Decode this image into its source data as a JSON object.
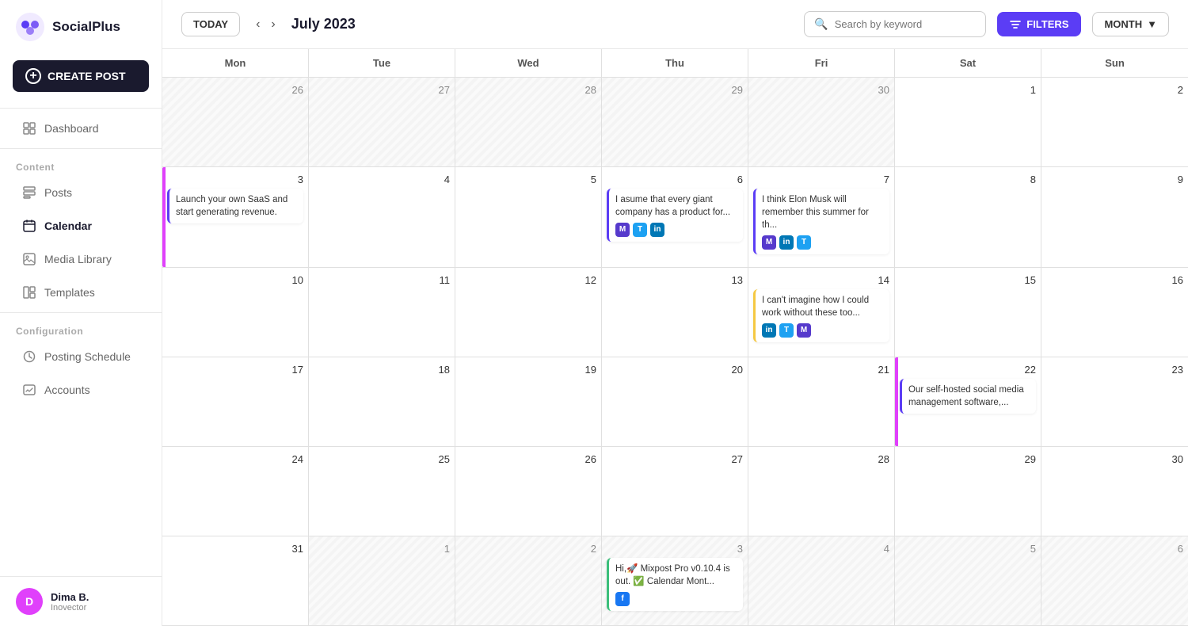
{
  "app": {
    "name": "SocialPlus"
  },
  "sidebar": {
    "create_post_label": "CREATE POST",
    "nav_items": [
      {
        "id": "dashboard",
        "label": "Dashboard",
        "icon": "dashboard-icon"
      },
      {
        "id": "content",
        "label": "Content",
        "section": true
      },
      {
        "id": "posts",
        "label": "Posts",
        "icon": "posts-icon"
      },
      {
        "id": "calendar",
        "label": "Calendar",
        "icon": "calendar-icon",
        "active": true
      },
      {
        "id": "media-library",
        "label": "Media Library",
        "icon": "media-icon"
      },
      {
        "id": "templates",
        "label": "Templates",
        "icon": "templates-icon"
      },
      {
        "id": "configuration",
        "label": "Configuration",
        "section": true
      },
      {
        "id": "posting-schedule",
        "label": "Posting Schedule",
        "icon": "schedule-icon"
      },
      {
        "id": "accounts",
        "label": "Accounts",
        "icon": "accounts-icon"
      }
    ],
    "user": {
      "name": "Dima B.",
      "org": "Inovector",
      "initial": "D"
    }
  },
  "topbar": {
    "today_label": "TODAY",
    "month_title": "July 2023",
    "search_placeholder": "Search by keyword",
    "filters_label": "FILTERS",
    "month_label": "MONTH"
  },
  "calendar": {
    "headers": [
      "Mon",
      "Tue",
      "Wed",
      "Thu",
      "Fri",
      "Sat",
      "Sun"
    ],
    "weeks": [
      {
        "days": [
          {
            "date": "26",
            "other": true,
            "events": []
          },
          {
            "date": "27",
            "other": true,
            "events": []
          },
          {
            "date": "28",
            "other": true,
            "events": []
          },
          {
            "date": "29",
            "other": true,
            "events": []
          },
          {
            "date": "30",
            "other": true,
            "events": []
          },
          {
            "date": "1",
            "other": false,
            "events": []
          },
          {
            "date": "2",
            "other": false,
            "events": []
          }
        ]
      },
      {
        "days": [
          {
            "date": "3",
            "other": false,
            "events": [
              {
                "text": "Launch your own SaaS and start generating revenue.",
                "color": "#5b3df5",
                "accent": "#e040fb",
                "socials": []
              }
            ]
          },
          {
            "date": "4",
            "other": false,
            "events": []
          },
          {
            "date": "5",
            "other": false,
            "events": []
          },
          {
            "date": "6",
            "other": false,
            "events": [
              {
                "text": "I asume that every giant company has a product for...",
                "color": "#5b3df5",
                "accent": "#5b3df5",
                "socials": [
                  "mastodon",
                  "twitter",
                  "linkedin"
                ]
              }
            ]
          },
          {
            "date": "7",
            "other": false,
            "events": [
              {
                "text": "I think Elon Musk will remember this summer for th...",
                "color": "#5b3df5",
                "accent": "#5b3df5",
                "socials": [
                  "mastodon",
                  "linkedin",
                  "twitter"
                ]
              }
            ]
          },
          {
            "date": "8",
            "other": false,
            "events": []
          },
          {
            "date": "9",
            "other": false,
            "events": []
          }
        ]
      },
      {
        "days": [
          {
            "date": "10",
            "other": false,
            "events": []
          },
          {
            "date": "11",
            "other": false,
            "events": []
          },
          {
            "date": "12",
            "other": false,
            "events": []
          },
          {
            "date": "13",
            "other": false,
            "events": []
          },
          {
            "date": "14",
            "other": false,
            "events": [
              {
                "text": "I can't imagine how I could work without these too...",
                "color": "#f5c842",
                "accent": "#f5c842",
                "socials": [
                  "linkedin",
                  "twitter",
                  "mastodon"
                ]
              }
            ]
          },
          {
            "date": "15",
            "other": false,
            "events": []
          },
          {
            "date": "16",
            "other": false,
            "events": []
          }
        ]
      },
      {
        "days": [
          {
            "date": "17",
            "other": false,
            "events": []
          },
          {
            "date": "18",
            "other": false,
            "events": []
          },
          {
            "date": "19",
            "other": false,
            "events": []
          },
          {
            "date": "20",
            "other": false,
            "events": []
          },
          {
            "date": "21",
            "other": false,
            "events": []
          },
          {
            "date": "22",
            "other": false,
            "events": [
              {
                "text": "Our self-hosted social media management software,...",
                "color": "#5b3df5",
                "accent": "#e040fb",
                "socials": []
              }
            ]
          },
          {
            "date": "23",
            "other": false,
            "events": []
          }
        ]
      },
      {
        "days": [
          {
            "date": "24",
            "other": false,
            "events": []
          },
          {
            "date": "25",
            "other": false,
            "events": []
          },
          {
            "date": "26",
            "other": false,
            "events": []
          },
          {
            "date": "27",
            "other": false,
            "events": []
          },
          {
            "date": "28",
            "other": false,
            "events": []
          },
          {
            "date": "29",
            "other": false,
            "events": []
          },
          {
            "date": "30",
            "other": false,
            "events": []
          }
        ]
      },
      {
        "days": [
          {
            "date": "31",
            "other": false,
            "events": []
          },
          {
            "date": "1",
            "other": true,
            "events": []
          },
          {
            "date": "2",
            "other": true,
            "events": []
          },
          {
            "date": "3",
            "other": true,
            "events": [
              {
                "text": "Hi,🚀 Mixpost Pro v0.10.4 is out. ✅ Calendar Mont...",
                "color": "#3bbf7a",
                "accent": "#3bbf7a",
                "socials": [
                  "facebook"
                ]
              }
            ]
          },
          {
            "date": "4",
            "other": true,
            "events": []
          },
          {
            "date": "5",
            "other": true,
            "events": []
          },
          {
            "date": "6",
            "other": true,
            "events": []
          }
        ]
      }
    ]
  }
}
